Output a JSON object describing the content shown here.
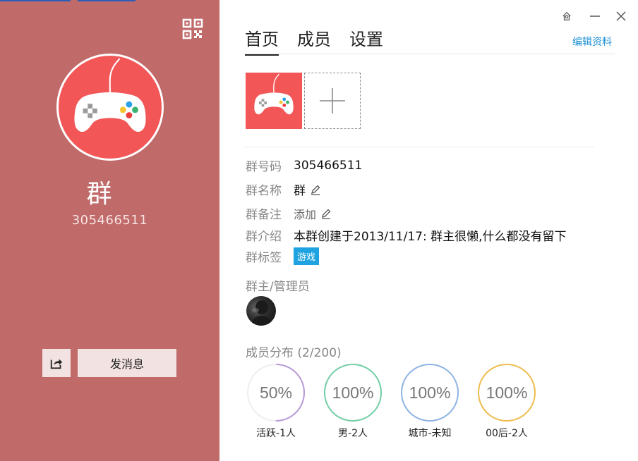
{
  "profile": {
    "name": "群",
    "number": "305466511",
    "send_message_label": "发消息"
  },
  "tabs": [
    {
      "label": "首页",
      "active": true
    },
    {
      "label": "成员",
      "active": false
    },
    {
      "label": "设置",
      "active": false
    }
  ],
  "edit_profile_label": "编辑资料",
  "info": {
    "number": {
      "label": "群号码",
      "value": "305466511"
    },
    "name": {
      "label": "群名称",
      "value": "群"
    },
    "remark": {
      "label": "群备注",
      "value": "添加"
    },
    "intro": {
      "label": "群介绍",
      "value": "本群创建于2013/11/17:  群主很懒,什么都没有留下"
    },
    "tags": {
      "label": "群标签",
      "value": "游戏"
    }
  },
  "admins_title": "群主/管理员",
  "distribution": {
    "title": "成员分布  (2/200)",
    "stats": [
      {
        "percent": 50,
        "text": "50%",
        "label": "活跃-1人",
        "color": "#b59ad8"
      },
      {
        "percent": 100,
        "text": "100%",
        "label": "男-2人",
        "color": "#73cfa7"
      },
      {
        "percent": 100,
        "text": "100%",
        "label": "城市-未知",
        "color": "#8fb4e3"
      },
      {
        "percent": 100,
        "text": "100%",
        "label": "00后-2人",
        "color": "#efbd4f"
      }
    ]
  },
  "colors": {
    "sidebar": "#c06a69",
    "avatar": "#f25656",
    "accent_link": "#1a8fd4",
    "tag": "#1ea3e0"
  },
  "icons": {
    "qr": "qr-code-icon",
    "share": "share-icon",
    "pin": "pin-icon",
    "minimize": "minimize-icon",
    "close": "close-icon",
    "edit": "pencil-icon",
    "add": "plus-icon",
    "avatar": "gamepad-icon"
  }
}
